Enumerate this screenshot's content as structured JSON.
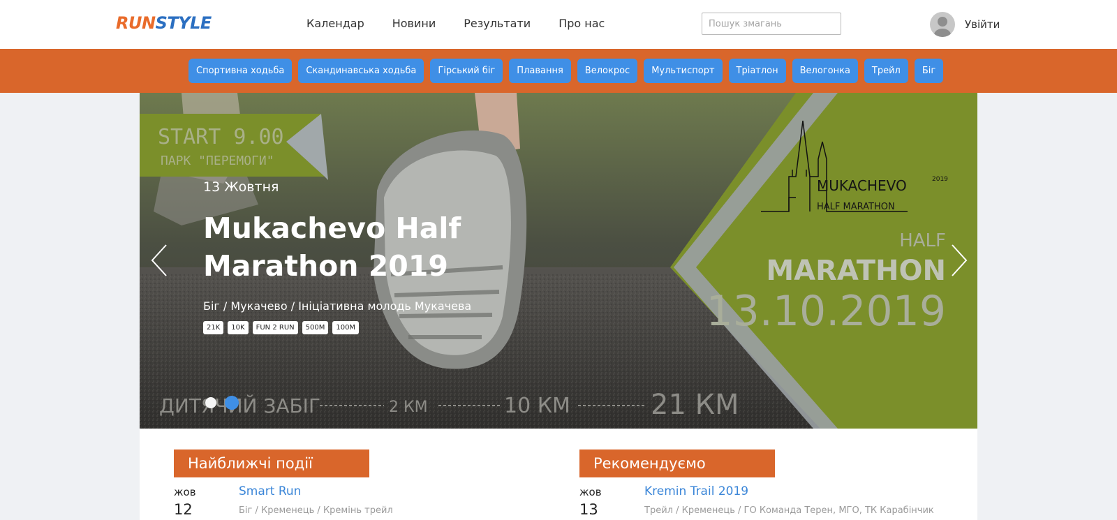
{
  "header": {
    "logo": {
      "part1": "RUN",
      "part2": "STYLE"
    },
    "nav": [
      "Календар",
      "Новини",
      "Результати",
      "Про нас"
    ],
    "search_placeholder": "Пошук змагань",
    "login_label": "Увійти"
  },
  "categories": [
    "Спортивна ходьба",
    "Скандинавська ходьба",
    "Гірський біг",
    "Плавання",
    "Велокрос",
    "Мультиспорт",
    "Тріатлон",
    "Велогонка",
    "Трейл",
    "Біг"
  ],
  "hero": {
    "date": "13 Жовтня",
    "title": "Mukachevo Half Marathon 2019",
    "subtitle": "Біг / Мукачево / Ініціативна молодь Мукачева",
    "distances": [
      "21K",
      "10K",
      "FUN 2 RUN",
      "500M",
      "100M"
    ],
    "poster": {
      "start": "START 9.00",
      "park": "ПАРК \"ПЕРЕМОГИ\"",
      "brand": "MUKACHEVO",
      "brand_year": "2019",
      "brand_sub": "HALF MARATHON",
      "half": "HALF",
      "marathon": "MARATHON",
      "big_date": "13.10.2019",
      "kids": "ДИТЯЧИЙ ЗАБІГ",
      "d2": "2 КМ",
      "d10": "10 КМ",
      "d21": "21 КМ"
    },
    "slide_count": 2,
    "active_slide": 2
  },
  "upcoming": {
    "heading": "Найближчі події",
    "events": [
      {
        "month": "жов",
        "day": "12",
        "title": "Smart Run",
        "meta": "Біг / Кременець / Кремінь трейл"
      }
    ]
  },
  "recommended": {
    "heading": "Рекомендуємо",
    "events": [
      {
        "month": "жов",
        "day": "13",
        "title": "Kremin Trail 2019",
        "meta": "Трейл / Кременець / ГО Команда Терен, МГО, ТК Карабінчик"
      }
    ]
  },
  "colors": {
    "accent_orange": "#d9662b",
    "accent_blue": "#3f8fe6",
    "poster_green": "#7b8f2a",
    "link_blue": "#3b86d8"
  },
  "icons": {
    "prev": "chevron-left-icon",
    "next": "chevron-right-icon",
    "avatar": "user-avatar-icon"
  }
}
